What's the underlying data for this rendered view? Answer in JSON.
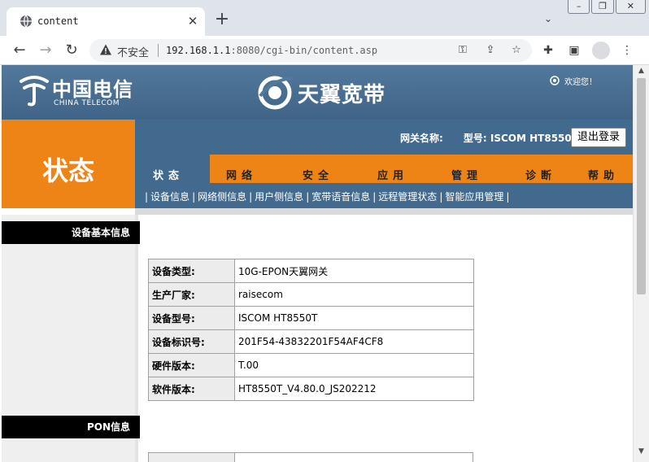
{
  "browser": {
    "tab_title": "content",
    "tab_close": "✕",
    "new_tab": "+",
    "insecure_label": "不安全",
    "url_host": "192.168.1.1",
    "url_rest": ":8080/cgi-bin/content.asp"
  },
  "header": {
    "brand_cn": "中国电信",
    "brand_en": "CHINA TELECOM",
    "product": "天翼宽带",
    "welcome": "欢迎您！"
  },
  "status_title": "状态",
  "gateway": {
    "name_label": "网关名称:",
    "model_label": "型号:",
    "model_value": "ISCOM HT8550T",
    "logout_label": "退出登录"
  },
  "nav": {
    "items": [
      "状态",
      "网络",
      "安全",
      "应用",
      "管理",
      "诊断",
      "帮助"
    ]
  },
  "subnav": {
    "items": [
      "设备信息",
      "网络侧信息",
      "用户侧信息",
      "宽带语音信息",
      "远程管理状态",
      "智能应用管理"
    ]
  },
  "sections": {
    "basic": "设备基本信息",
    "pon": "PON信息"
  },
  "device_info": [
    {
      "label": "设备类型:",
      "value": "10G-EPON天翼网关"
    },
    {
      "label": "生产厂家:",
      "value": "raisecom"
    },
    {
      "label": "设备型号:",
      "value": "ISCOM HT8550T"
    },
    {
      "label": "设备标识号:",
      "value": "201F54-43832201F54AF4CF8"
    },
    {
      "label": "硬件版本:",
      "value": "T.00"
    },
    {
      "label": "软件版本:",
      "value": "HT8550T_V4.80.0_JS202212"
    }
  ]
}
